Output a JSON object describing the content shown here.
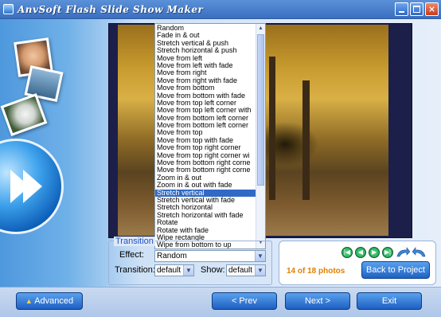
{
  "window": {
    "title": "AnvSoft Flash Slide Show Maker"
  },
  "effects_list": {
    "items": [
      "Random",
      "Fade in & out",
      "Stretch vertical & push",
      "Stretch horizontal & push",
      "Move from left",
      "Move from left with fade",
      "Move from right",
      "Move from right with fade",
      "Move from bottom",
      "Move from bottom with fade",
      "Move from top left corner",
      "Move from top left corner with",
      "Move from bottom left corner",
      "Move from bottom left corner",
      "Move from top",
      "Move from top with fade",
      "Move from top right corner",
      "Move from top right corner wi",
      "Move from bottom right corne",
      "Move from bottom right corne",
      "Zoom in & out",
      "Zoom in & out with fade",
      "Stretch vertical",
      "Stretch vertical with fade",
      "Stretch horizontal",
      "Stretch horizontal with fade",
      "Rotate",
      "Rotate with fade",
      "Wipe rectangle",
      "Wipe from bottom to up"
    ],
    "selected_index": 22
  },
  "transition": {
    "legend": "Transition",
    "effect_label": "Effect:",
    "effect_value": "Random",
    "transition_label": "Transition:",
    "transition_value": "default",
    "show_label": "Show:",
    "show_value": "default"
  },
  "navigator": {
    "count_text": "14 of 18 photos",
    "back_label": "Back to Project"
  },
  "bottom_bar": {
    "advanced_label": "Advanced",
    "prev_label": "< Prev",
    "next_label": "Next >",
    "exit_label": "Exit"
  }
}
